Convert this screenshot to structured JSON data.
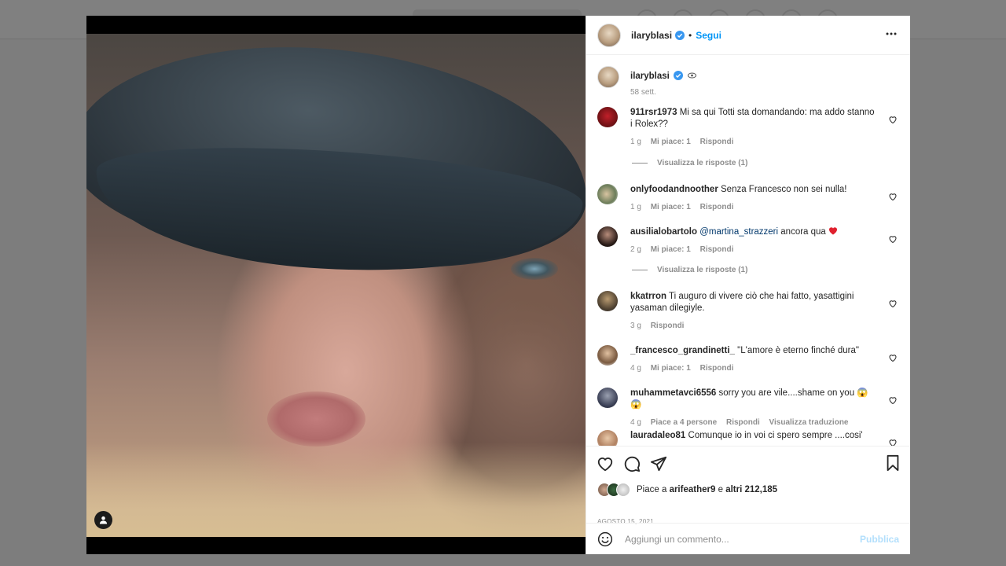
{
  "post": {
    "username": "ilaryblasi",
    "follow_label": "Segui",
    "caption_time": "58 sett."
  },
  "comments": [
    {
      "user": "911rsr1973",
      "text": "Mi sa qui Totti sta domandando: ma addo stanno i Rolex??",
      "time": "1 g",
      "likes": "Mi piace: 1",
      "reply": "Rispondi",
      "replies": "Visualizza le risposte (1)"
    },
    {
      "user": "onlyfoodandnoother",
      "text": "Senza Francesco non sei nulla!",
      "time": "1 g",
      "likes": "Mi piace: 1",
      "reply": "Rispondi"
    },
    {
      "user": "ausilialobartolo",
      "mention": "@martina_strazzeri",
      "text": "ancora qua",
      "time": "2 g",
      "likes": "Mi piace: 1",
      "reply": "Rispondi",
      "replies": "Visualizza le risposte (1)"
    },
    {
      "user": "kkatrron",
      "text": "Ti auguro di vivere ciò che hai fatto, yasattigini yasaman dilegiyle.",
      "time": "3 g",
      "reply": "Rispondi"
    },
    {
      "user": "_francesco_grandinetti_",
      "text": "\"L'amore è eterno finché dura\"",
      "time": "4 g",
      "likes": "Mi piace: 1",
      "reply": "Rispondi"
    },
    {
      "user": "muhammetavci6556",
      "text": "sorry you are vile....shame on you 😱😱",
      "time": "4 g",
      "likes": "Piace a 4 persone",
      "reply": "Rispondi",
      "translate": "Visualizza traduzione"
    },
    {
      "user": "lauradaleo81",
      "text": "Comunque io in voi ci spero sempre ....cosi'"
    }
  ],
  "actions": {
    "likes_prefix": "Piace a",
    "likes_user": "arifeather9",
    "likes_mid": "e",
    "likes_others": "altri 212,185",
    "date": "AGOSTO 15, 2021"
  },
  "add_comment": {
    "placeholder": "Aggiungi un commento...",
    "publish_label": "Pubblica"
  },
  "colors": {
    "accent": "#0095f6",
    "publish_disabled": "#b2dffc",
    "heart_red": "#ed4956"
  }
}
